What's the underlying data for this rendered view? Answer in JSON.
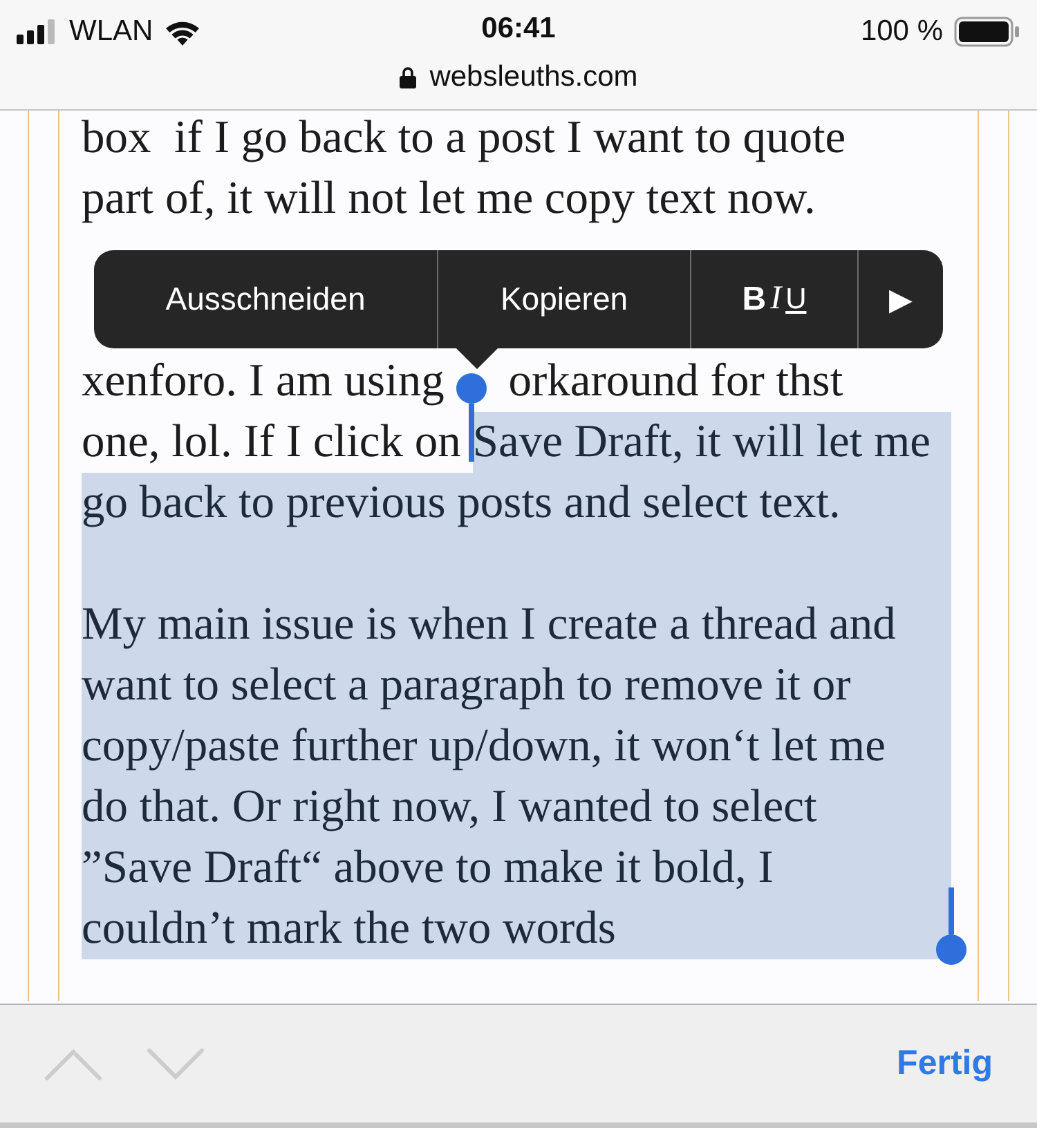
{
  "status_bar": {
    "carrier": "WLAN",
    "time": "06:41",
    "battery": "100 %"
  },
  "address_bar": {
    "url": "websleuths.com",
    "secure": true
  },
  "lines": [
    {
      "segments": [
        {
          "text": "box  if I go back to a post I want to quote",
          "selected": false
        }
      ]
    },
    {
      "segments": [
        {
          "text": "part of, it will not let me copy text now.",
          "selected": false
        }
      ]
    },
    {
      "blank": true,
      "selected": false
    },
    {
      "blank": true,
      "selected": false
    },
    {
      "segments": [
        {
          "text": "xenforo. I am using ",
          "selected": false
        },
        {
          "text": "orkaround for thst",
          "selected": false
        }
      ]
    },
    {
      "segments": [
        {
          "text": "one, lol. If I click on ",
          "selected": false
        },
        {
          "text": "Save Draft, it will let me",
          "selected": true
        }
      ]
    },
    {
      "segments": [
        {
          "text": "go back to previous posts and select text.",
          "selected": true
        }
      ]
    },
    {
      "blank": true,
      "selected": true
    },
    {
      "segments": [
        {
          "text": "My main issue is when I create a thread and",
          "selected": true
        }
      ]
    },
    {
      "segments": [
        {
          "text": "want to select a paragraph to remove it or",
          "selected": true
        }
      ]
    },
    {
      "segments": [
        {
          "text": "copy/paste further up/down, it won‘t let me",
          "selected": true
        }
      ]
    },
    {
      "segments": [
        {
          "text": "do that. Or right now, I wanted to select",
          "selected": true
        }
      ]
    },
    {
      "segments": [
        {
          "text": "”Save Draft“ above to make it bold, I",
          "selected": true
        }
      ]
    },
    {
      "segments": [
        {
          "text": "couldn’t mark the two words",
          "selected": true
        }
      ]
    }
  ],
  "edit_menu": [
    {
      "kind": "text",
      "label": "Ausschneiden"
    },
    {
      "kind": "text",
      "label": "Kopieren"
    },
    {
      "kind": "format",
      "letters": [
        "B",
        "I",
        "U"
      ]
    },
    {
      "kind": "more",
      "label": "▶"
    }
  ],
  "toolbar": {
    "previous": {
      "disabled": true
    },
    "next": {
      "disabled": true
    },
    "done": "Fertig"
  }
}
